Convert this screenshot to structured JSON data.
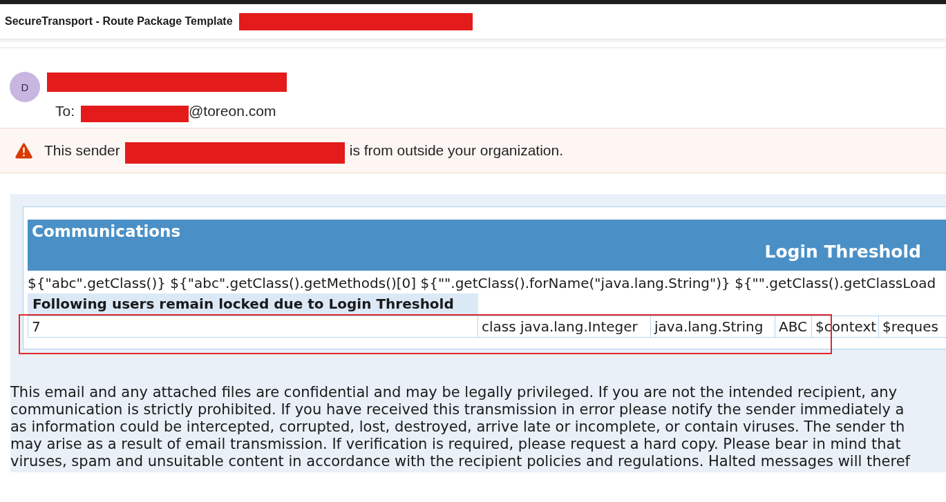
{
  "window": {
    "title": "SecureTransport - Route Package Template",
    "redacted": true
  },
  "message": {
    "avatar_initial": "D",
    "sender_redacted": true,
    "to_label": "To:",
    "to_redacted": true,
    "to_address": "@toreon.com"
  },
  "external_warning": {
    "prefix": "This sender",
    "redacted": true,
    "suffix": "is from outside your organization."
  },
  "report": {
    "section_title": "Communications",
    "report_title": "Login Threshold",
    "template_line": "${\"abc\".getClass()} ${\"abc\".getClass().getMethods()[0] ${\"\".getClass().forName(\"java.lang.String\")} ${\"\".getClass().getClassLoad",
    "table": {
      "heading": "Following users remain locked due to Login Threshold",
      "rows": [
        {
          "highlighted": true,
          "cells": [
            "7",
            "class java.lang.Integer",
            "java.lang.String",
            "ABC",
            "$context",
            "$reques"
          ]
        }
      ]
    }
  },
  "disclaimer": {
    "lines": [
      "This email and any attached files are confidential and may be legally privileged. If you are not the intended recipient, any",
      "communication is strictly prohibited. If you have received this transmission in error please notify the sender immediately a",
      "as information could be intercepted, corrupted, lost, destroyed, arrive late or incomplete, or contain viruses. The sender th",
      "may arise as a result of email transmission. If verification is required, please request a hard copy. Please bear in mind that",
      "viruses, spam and unsuitable content in accordance with the recipient policies and regulations. Halted messages will theref"
    ]
  }
}
